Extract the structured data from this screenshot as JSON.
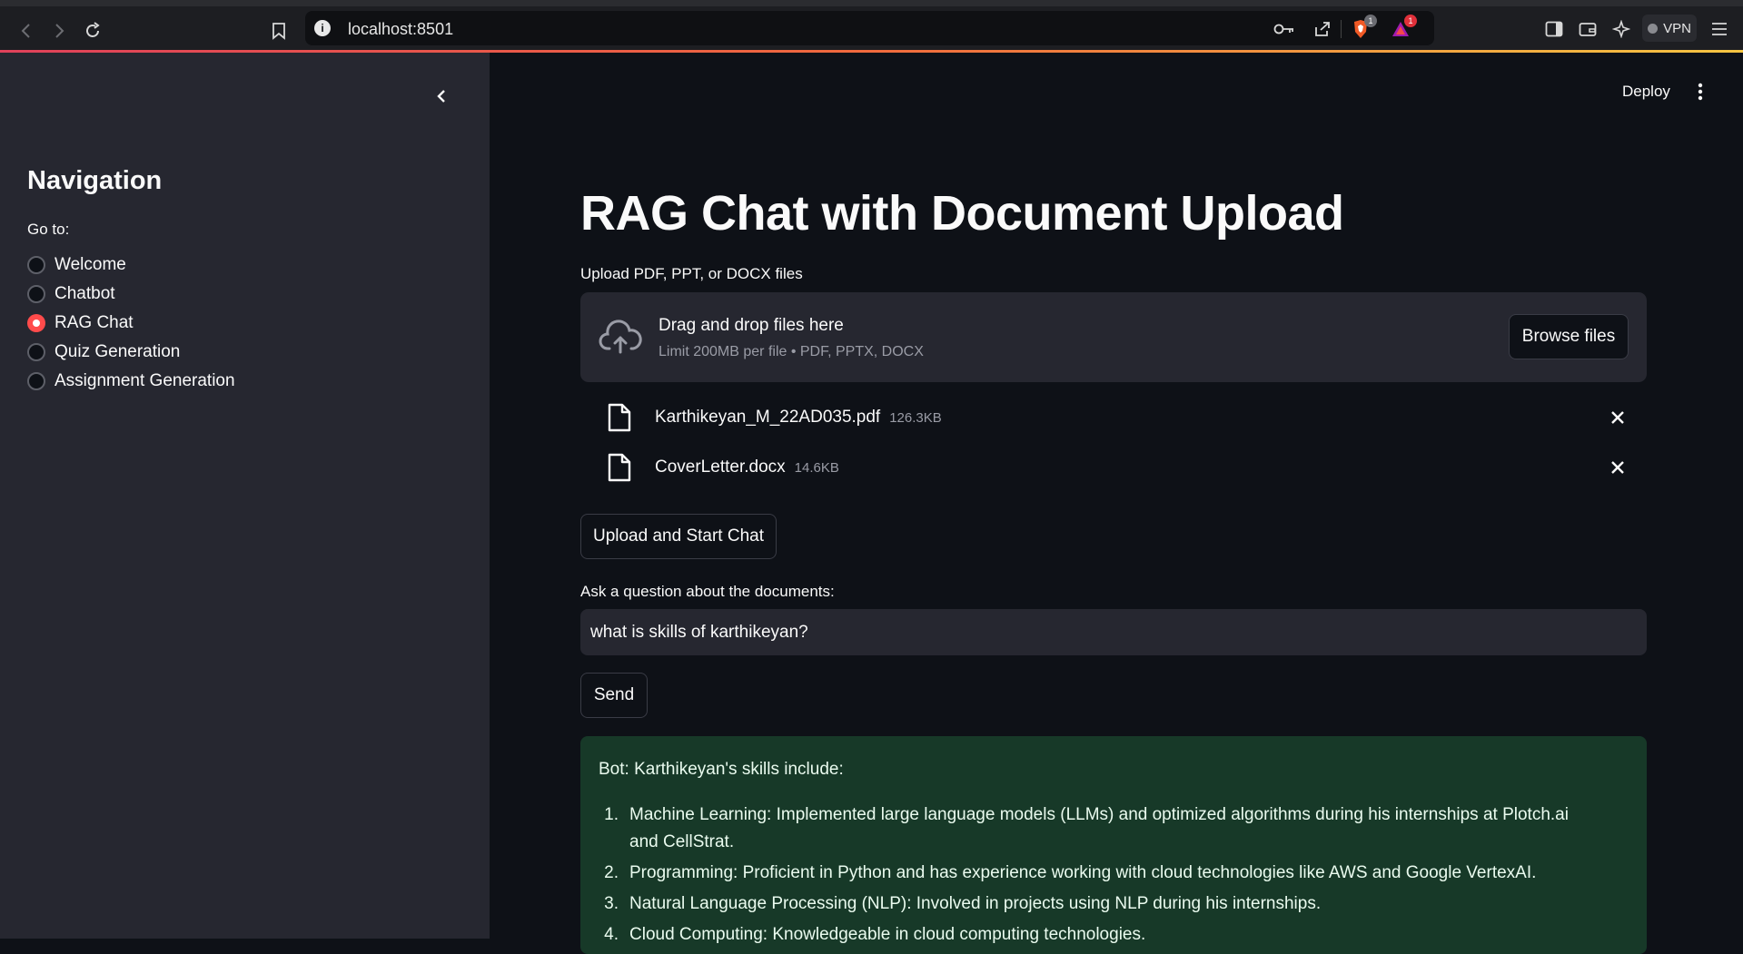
{
  "browser": {
    "url": "localhost:8501",
    "brave_badge": "1",
    "alert_badge": "1",
    "vpn_label": "VPN"
  },
  "sidebar": {
    "title": "Navigation",
    "goto_label": "Go to:",
    "options": [
      {
        "label": "Welcome",
        "selected": false
      },
      {
        "label": "Chatbot",
        "selected": false
      },
      {
        "label": "RAG Chat",
        "selected": true
      },
      {
        "label": "Quiz Generation",
        "selected": false
      },
      {
        "label": "Assignment Generation",
        "selected": false
      }
    ]
  },
  "header": {
    "deploy_label": "Deploy"
  },
  "main": {
    "title": "RAG Chat with Document Upload",
    "upload_label": "Upload PDF, PPT, or DOCX files",
    "dropzone": {
      "title": "Drag and drop files here",
      "subtitle": "Limit 200MB per file • PDF, PPTX, DOCX",
      "browse_label": "Browse files"
    },
    "files": [
      {
        "name": "Karthikeyan_M_22AD035.pdf",
        "size": "126.3KB"
      },
      {
        "name": "CoverLetter.docx",
        "size": "14.6KB"
      }
    ],
    "upload_button": "Upload and Start Chat",
    "ask_label": "Ask a question about the documents:",
    "question_value": "what is skills of karthikeyan?",
    "send_button": "Send",
    "answer": {
      "intro": "Bot: Karthikeyan's skills include:",
      "items": [
        {
          "num": "1.",
          "text": "Machine Learning: Implemented large language models (LLMs) and optimized algorithms during his internships at Plotch.ai and CellStrat."
        },
        {
          "num": "2.",
          "text": "Programming: Proficient in Python and has experience working with cloud technologies like AWS and Google VertexAI."
        },
        {
          "num": "3.",
          "text": "Natural Language Processing (NLP): Involved in projects using NLP during his internships."
        },
        {
          "num": "4.",
          "text": "Cloud Computing: Knowledgeable in cloud computing technologies."
        }
      ]
    }
  },
  "colors": {
    "accent": "#ff4b4b",
    "sidebar_bg": "#262730",
    "main_bg": "#0e1117",
    "answer_bg": "#173928"
  }
}
